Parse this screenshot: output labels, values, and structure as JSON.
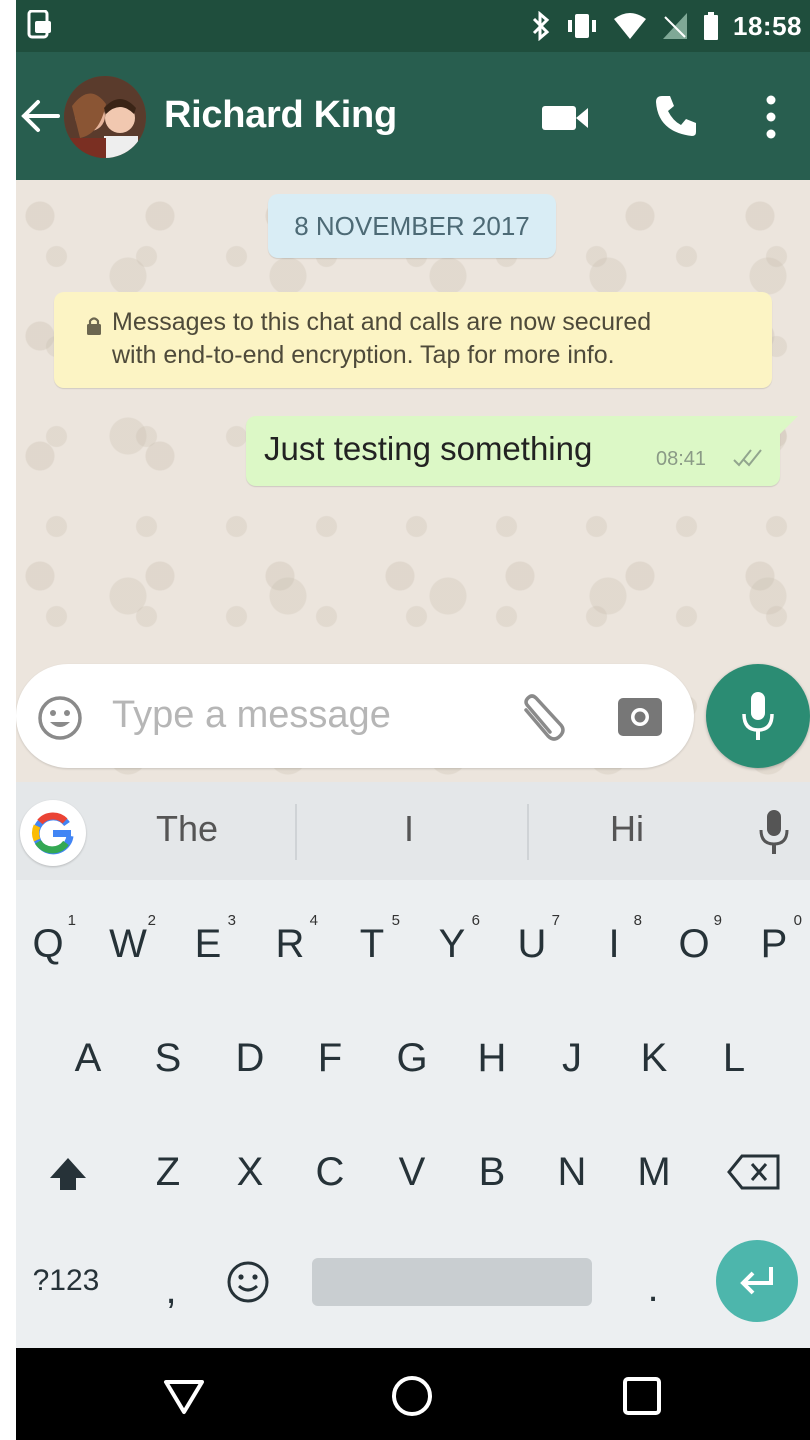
{
  "status_bar": {
    "time": "18:58",
    "icons": [
      "screenshot-icon",
      "bluetooth-icon",
      "vibrate-icon",
      "wifi-icon",
      "no-signal-icon",
      "battery-icon"
    ]
  },
  "app_bar": {
    "contact_name": "Richard King",
    "icons": [
      "back-arrow-icon",
      "video-call-icon",
      "phone-icon",
      "more-vert-icon"
    ]
  },
  "chat": {
    "date_chip": "8 NOVEMBER 2017",
    "encryption_notice": {
      "line1": "Messages to this chat and calls are now secured",
      "line2": "with end-to-end encryption. Tap for more info."
    },
    "messages": [
      {
        "text": "Just testing something",
        "time": "08:41",
        "status": "double-check-icon"
      }
    ]
  },
  "input": {
    "placeholder": "Type a message"
  },
  "keyboard": {
    "suggestions": [
      "The",
      "I",
      "Hi"
    ],
    "row1": [
      {
        "key": "Q",
        "sup": "1"
      },
      {
        "key": "W",
        "sup": "2"
      },
      {
        "key": "E",
        "sup": "3"
      },
      {
        "key": "R",
        "sup": "4"
      },
      {
        "key": "T",
        "sup": "5"
      },
      {
        "key": "Y",
        "sup": "6"
      },
      {
        "key": "U",
        "sup": "7"
      },
      {
        "key": "I",
        "sup": "8"
      },
      {
        "key": "O",
        "sup": "9"
      },
      {
        "key": "P",
        "sup": "0"
      }
    ],
    "row2": [
      "A",
      "S",
      "D",
      "F",
      "G",
      "H",
      "J",
      "K",
      "L"
    ],
    "row3": [
      "Z",
      "X",
      "C",
      "V",
      "B",
      "N",
      "M"
    ],
    "row4": {
      "symbols": "?123",
      "comma": ",",
      "period": "."
    }
  },
  "colors": {
    "status_bar": "#1f4e3d",
    "app_bar": "#285e4f",
    "outgoing_bubble": "#dcf8c6",
    "date_chip": "#d9edf5",
    "encryption_notice": "#fcf4c4",
    "mic_button": "#2b8c73",
    "enter_key": "#4db6ac"
  }
}
